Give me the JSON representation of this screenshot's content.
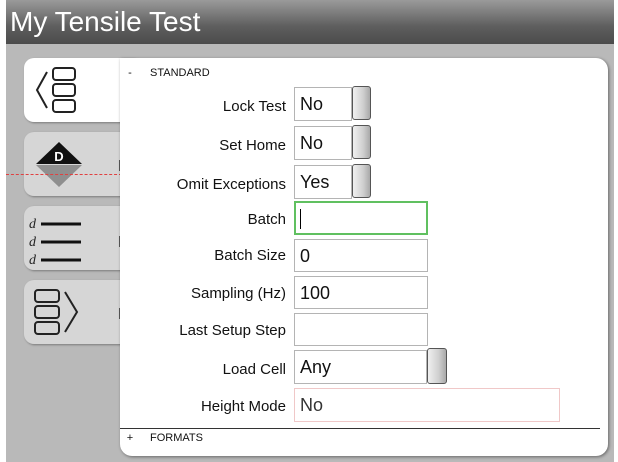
{
  "window": {
    "title": "My Tensile Test"
  },
  "tabs": [
    {
      "icon": "parameter-list-icon",
      "letter": ""
    },
    {
      "icon": "diamond-d-icon",
      "letter": "F"
    },
    {
      "icon": "d-lines-icon",
      "letter": "D"
    },
    {
      "icon": "boxes-arrow-icon",
      "letter": "F"
    }
  ],
  "sections": {
    "standard": {
      "sign": "-",
      "label": "STANDARD"
    },
    "formats": {
      "sign": "+",
      "label": "FORMATS"
    }
  },
  "fields": {
    "lock_test": {
      "label": "Lock Test",
      "value": "No"
    },
    "set_home": {
      "label": "Set Home",
      "value": "No"
    },
    "omit_exceptions": {
      "label": "Omit Exceptions",
      "value": "Yes"
    },
    "batch": {
      "label": "Batch",
      "value": ""
    },
    "batch_size": {
      "label": "Batch Size",
      "value": "0"
    },
    "sampling": {
      "label": "Sampling (Hz)",
      "value": "100"
    },
    "last_setup_step": {
      "label": "Last Setup Step",
      "value": ""
    },
    "load_cell": {
      "label": "Load Cell",
      "value": "Any"
    },
    "height_mode": {
      "label": "Height Mode",
      "value": "No"
    }
  },
  "colors": {
    "focus_border": "#60c060",
    "dashed_line": "#e04040",
    "title_bar": "#4b4b4b"
  }
}
